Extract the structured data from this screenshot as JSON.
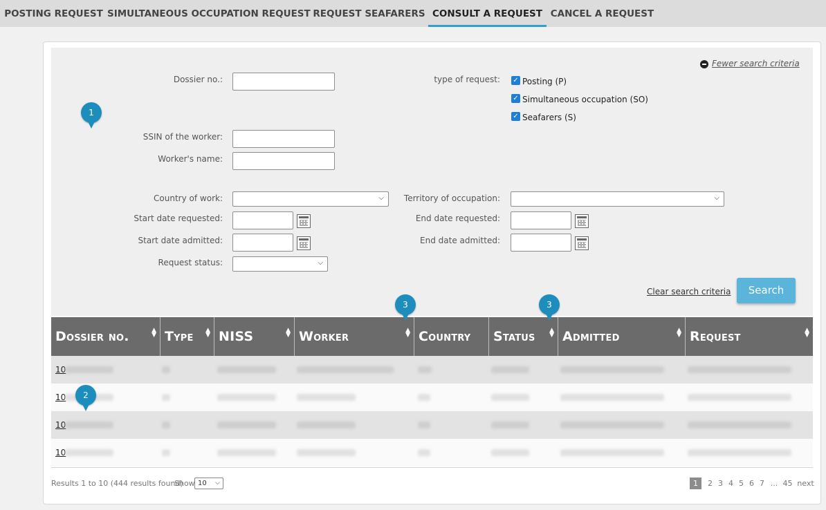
{
  "nav": {
    "tabs": [
      {
        "label": "POSTING REQUEST"
      },
      {
        "label": "SIMULTANEOUS OCCUPATION REQUEST"
      },
      {
        "label": "REQUEST SEAFARERS"
      },
      {
        "label": "CONSULT A REQUEST",
        "active": true
      },
      {
        "label": "CANCEL A REQUEST"
      }
    ]
  },
  "criteria": {
    "fewer_link": "Fewer search criteria",
    "dossier_label": "Dossier no.:",
    "dossier_value": "",
    "type_label": "type of request:",
    "types": [
      {
        "label": "Posting (P)",
        "checked": true
      },
      {
        "label": "Simultaneous occupation (SO)",
        "checked": true
      },
      {
        "label": "Seafarers (S)",
        "checked": true
      }
    ],
    "ssin_label": "SSIN of the worker:",
    "ssin_value": "",
    "worker_label": "Worker's name:",
    "worker_value": "",
    "country_label": "Country of work:",
    "country_value": "",
    "territory_label": "Territory of occupation:",
    "territory_value": "",
    "start_req_label": "Start date requested:",
    "end_req_label": "End date requested:",
    "start_adm_label": "Start date admitted:",
    "end_adm_label": "End date admitted:",
    "status_label": "Request status:",
    "status_value": "",
    "clear_link": "Clear search criteria",
    "search_button": "Search"
  },
  "markers": [
    "1",
    "2",
    "3",
    "3"
  ],
  "table": {
    "columns": [
      "Dossier no.",
      "Type",
      "NISS",
      "Worker",
      "Country",
      "Status",
      "Admitted",
      "Request"
    ],
    "rows": [
      {
        "dossier_prefix": "10"
      },
      {
        "dossier_prefix": "10"
      },
      {
        "dossier_prefix": "10"
      },
      {
        "dossier_prefix": "10"
      }
    ]
  },
  "footer": {
    "results": "Results 1 to 10 (444 results found)",
    "show_label": "Show",
    "show_value": "10",
    "pages": [
      "1",
      "2",
      "3",
      "4",
      "5",
      "6",
      "7",
      "...",
      "45",
      "next"
    ],
    "current_page": "1"
  },
  "colors": {
    "accent": "#2f9fd0",
    "search_button": "#5bb4d9",
    "table_header": "#6b6b6b",
    "marker": "#1d8dbd",
    "checkbox": "#1f7fd6"
  }
}
